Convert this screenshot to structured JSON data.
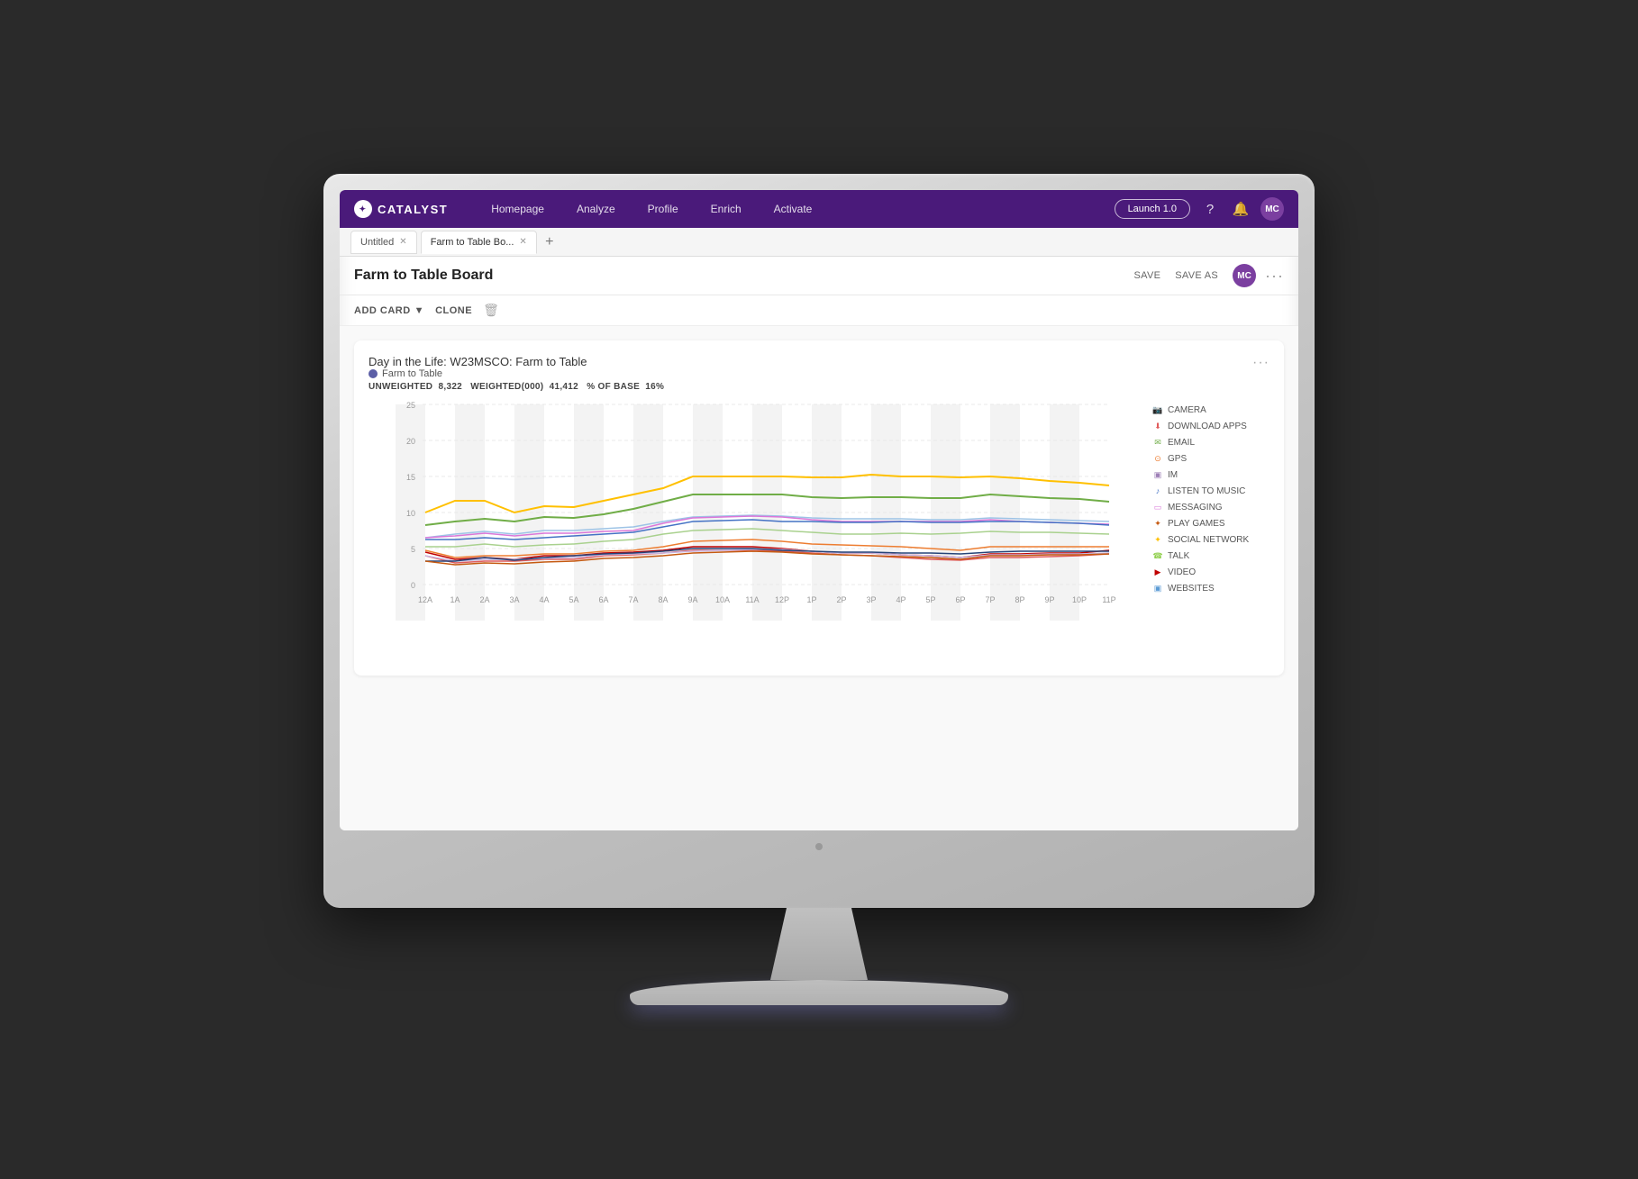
{
  "app": {
    "name": "CATALYST",
    "logo_icon": "✦"
  },
  "nav": {
    "links": [
      "Homepage",
      "Analyze",
      "Profile",
      "Enrich",
      "Activate"
    ],
    "launch_btn": "Launch 1.0",
    "avatar_initials": "MC"
  },
  "tabs": [
    {
      "label": "Untitled",
      "active": false,
      "closeable": true
    },
    {
      "label": "Farm to Table Bo...",
      "active": true,
      "closeable": true
    }
  ],
  "board": {
    "title": "Farm to Table Board",
    "save_label": "SAVE",
    "save_as_label": "SAVE AS",
    "avatar_initials": "MC",
    "more_label": "···"
  },
  "actions": {
    "add_card_label": "ADD CARD",
    "clone_label": "CLONE"
  },
  "card": {
    "title": "Day in the Life: W23MSCO: Farm to Table",
    "legend_segment": "Farm to Table",
    "legend_color": "#5b5ea6",
    "stats": {
      "unweighted_label": "UNWEIGHTED",
      "unweighted_value": "8,322",
      "weighted_label": "WEIGHTED(000)",
      "weighted_value": "41,412",
      "base_label": "% OF BASE",
      "base_value": "16%"
    }
  },
  "chart": {
    "x_labels": [
      "12A",
      "1A",
      "2A",
      "3A",
      "4A",
      "5A",
      "6A",
      "7A",
      "8A",
      "9A",
      "10A",
      "11A",
      "12P",
      "1P",
      "2P",
      "3P",
      "4P",
      "5P",
      "6P",
      "7P",
      "8P",
      "9P",
      "10P",
      "11P"
    ],
    "y_labels": [
      "0",
      "5",
      "10",
      "15",
      "20",
      "25"
    ],
    "y_max": 30
  },
  "legend_items": [
    {
      "label": "CAMERA",
      "color": "#5b9bd5",
      "icon": "📷"
    },
    {
      "label": "DOWNLOAD APPS",
      "color": "#e05c5c",
      "icon": "⬇"
    },
    {
      "label": "EMAIL",
      "color": "#70ad47",
      "icon": "✉"
    },
    {
      "label": "GPS",
      "color": "#ed7d31",
      "icon": "⊙"
    },
    {
      "label": "IM",
      "color": "#9e80b7",
      "icon": "▣"
    },
    {
      "label": "LISTEN TO MUSIC",
      "color": "#4472c4",
      "icon": "♪"
    },
    {
      "label": "MESSAGING",
      "color": "#da77d9",
      "icon": "▭"
    },
    {
      "label": "PLAY GAMES",
      "color": "#c55a11",
      "icon": "✦"
    },
    {
      "label": "SOCIAL NETWORK",
      "color": "#ffc000",
      "icon": "✦"
    },
    {
      "label": "TALK",
      "color": "#92d050",
      "icon": "☎"
    },
    {
      "label": "VIDEO",
      "color": "#c00000",
      "icon": "▶"
    },
    {
      "label": "WEBSITES",
      "color": "#5b9bd5",
      "icon": "▣"
    }
  ]
}
